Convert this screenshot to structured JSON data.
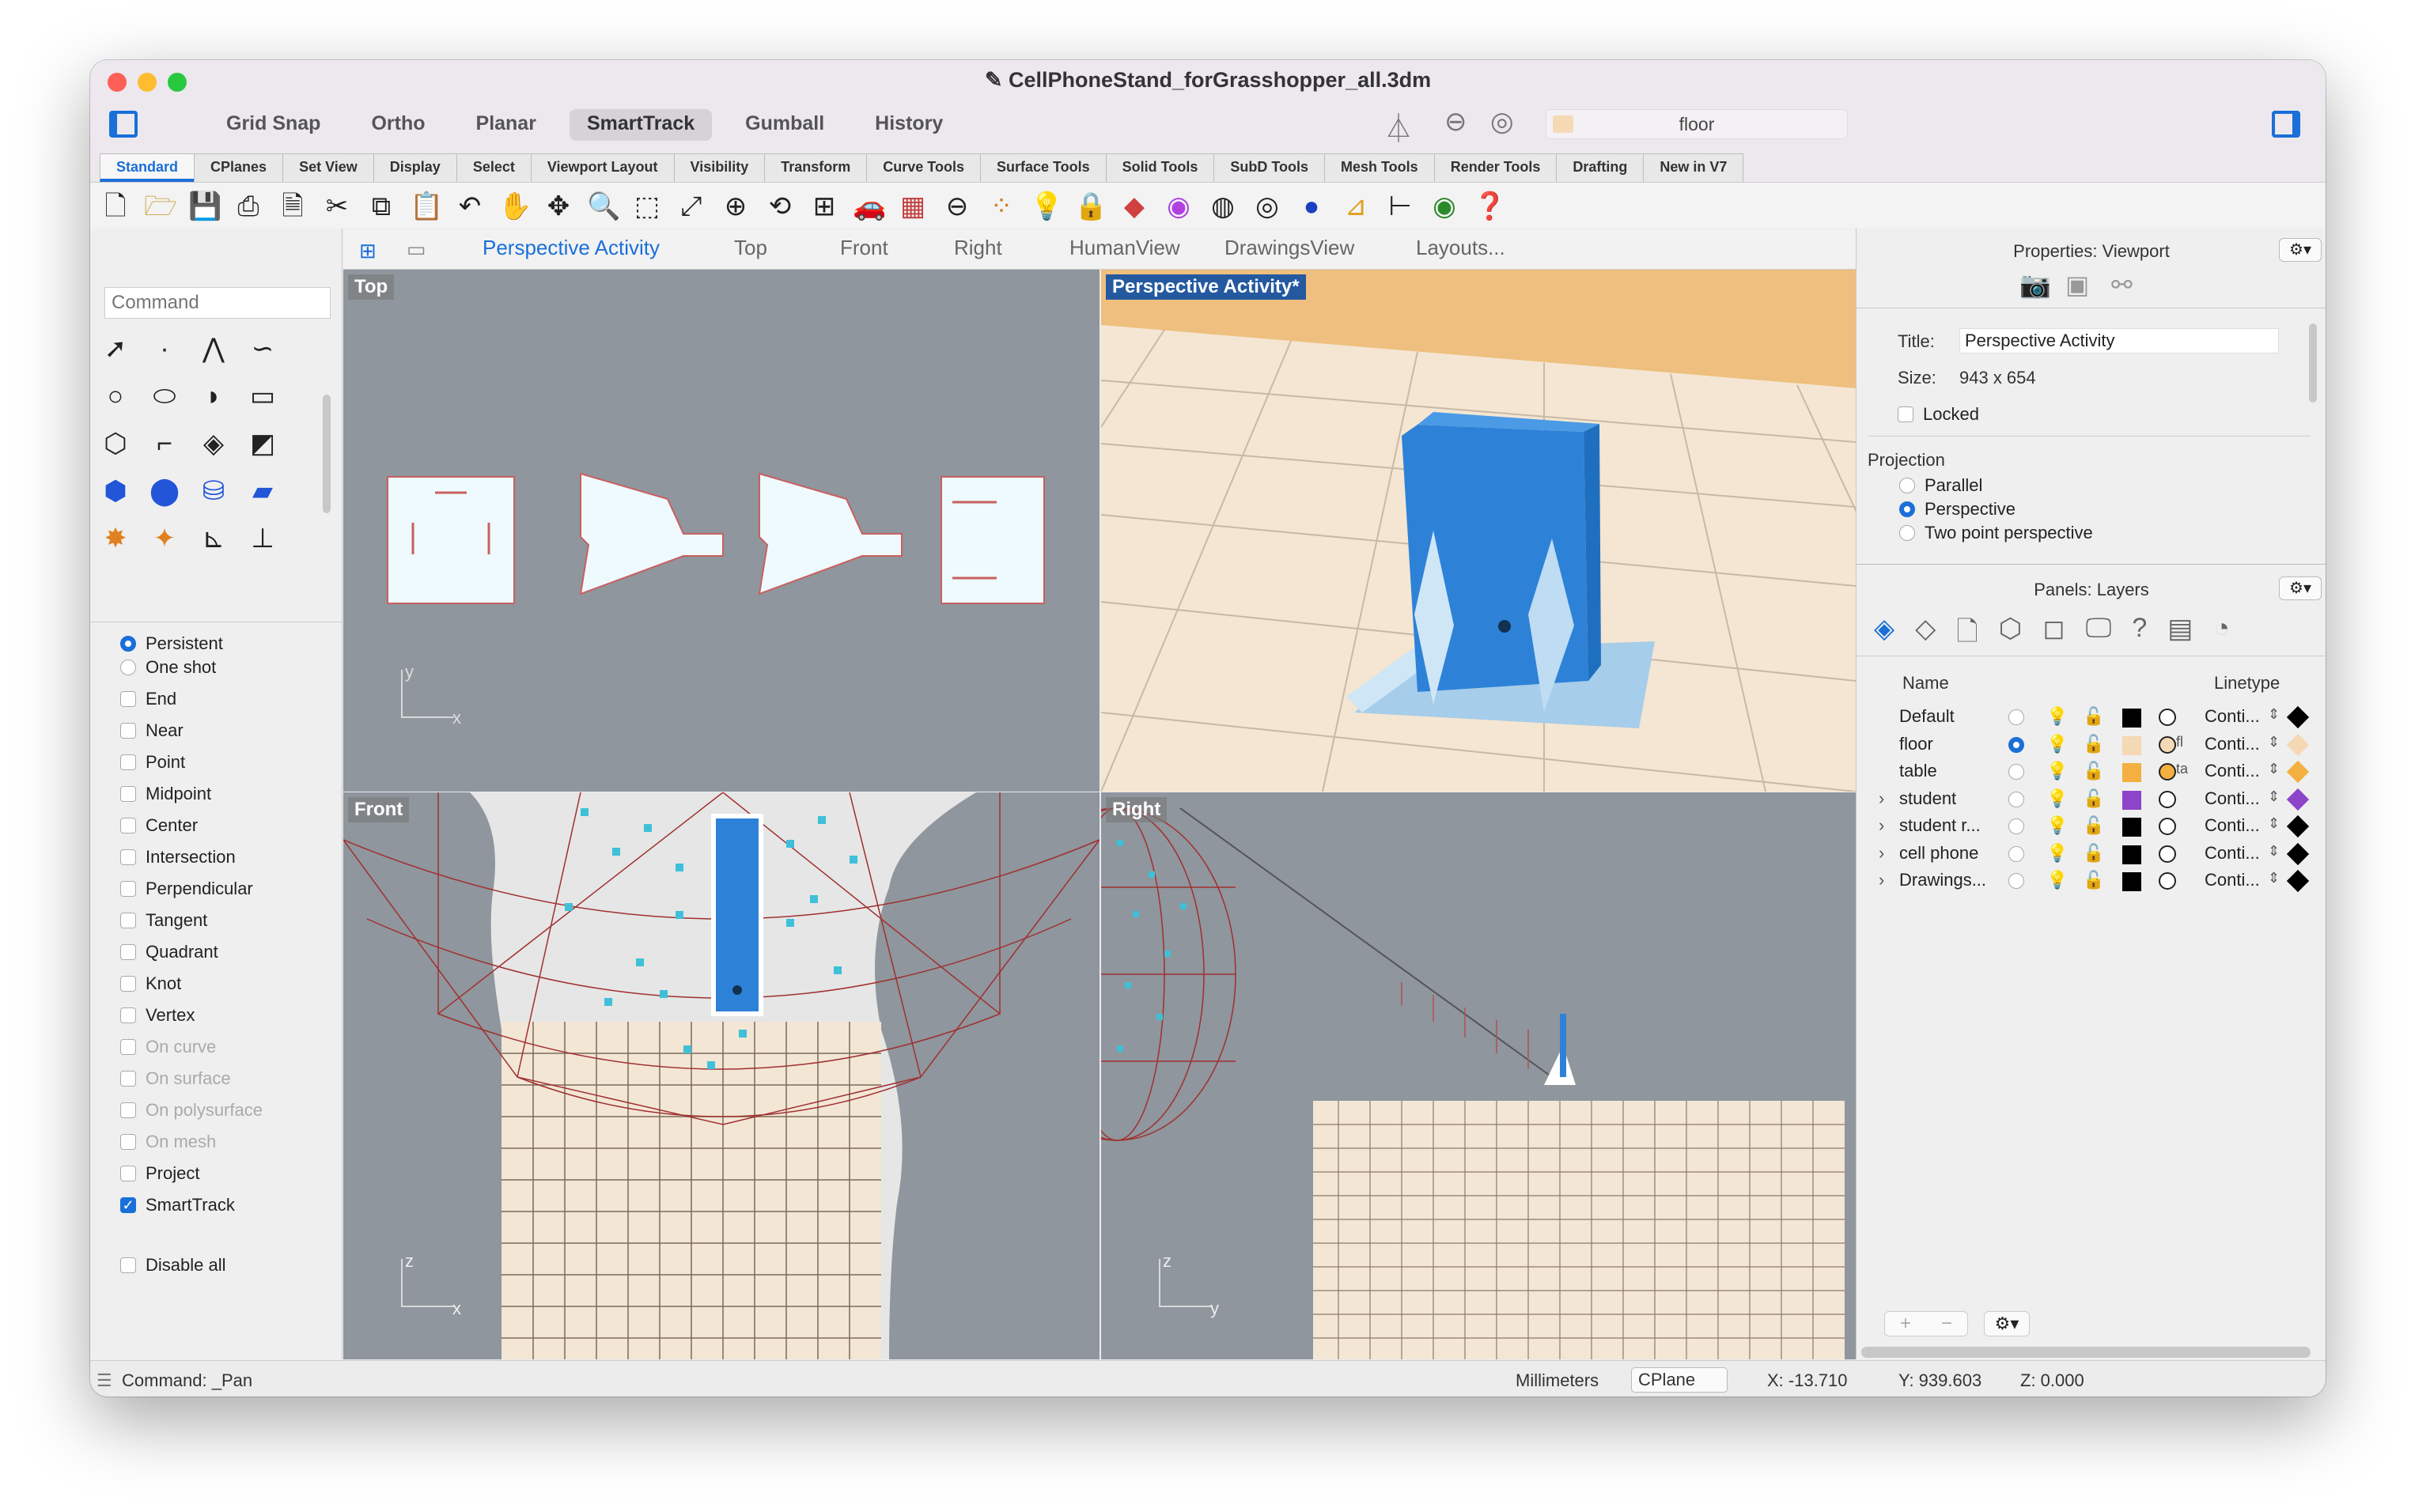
{
  "window": {
    "title": "CellPhoneStand_forGrasshopper_all.3dm"
  },
  "modes": [
    "Grid Snap",
    "Ortho",
    "Planar",
    "SmartTrack",
    "Gumball",
    "History"
  ],
  "active_mode": "SmartTrack",
  "current_layer": "floor",
  "tabs": [
    "Standard",
    "CPlanes",
    "Set View",
    "Display",
    "Select",
    "Viewport Layout",
    "Visibility",
    "Transform",
    "Curve Tools",
    "Surface Tools",
    "Solid Tools",
    "SubD Tools",
    "Mesh Tools",
    "Render Tools",
    "Drafting",
    "New in V7"
  ],
  "command": {
    "placeholder": "Command"
  },
  "osnap": {
    "persistent": "Persistent",
    "one_shot": "One shot",
    "items": [
      "End",
      "Near",
      "Point",
      "Midpoint",
      "Center",
      "Intersection",
      "Perpendicular",
      "Tangent",
      "Quadrant",
      "Knot",
      "Vertex"
    ],
    "disabled_items": [
      "On curve",
      "On surface",
      "On polysurface",
      "On mesh"
    ],
    "project": "Project",
    "smarttrack": "SmartTrack",
    "disable_all": "Disable all"
  },
  "viewport_tabs": [
    "Perspective Activity",
    "Top",
    "Front",
    "Right",
    "HumanView",
    "DrawingsView",
    "Layouts..."
  ],
  "viewports": {
    "top": "Top",
    "perspective": "Perspective Activity*",
    "front": "Front",
    "right": "Right"
  },
  "axes": {
    "x": "x",
    "y": "y",
    "z": "z"
  },
  "properties": {
    "header": "Properties: Viewport",
    "title_label": "Title:",
    "title_value": "Perspective Activity",
    "size_label": "Size:",
    "size_value": "943 x 654",
    "locked": "Locked",
    "projection": "Projection",
    "parallel": "Parallel",
    "perspective": "Perspective",
    "two_point": "Two point perspective"
  },
  "layers": {
    "header": "Panels: Layers",
    "col_name": "Name",
    "col_linetype": "Linetype",
    "rows": [
      {
        "name": "Default",
        "color": "#000000",
        "linetype": "Conti...",
        "current": false,
        "expandable": false,
        "mat": ""
      },
      {
        "name": "floor",
        "color": "#f4d9b4",
        "linetype": "Conti...",
        "current": true,
        "expandable": false,
        "mat": "fl"
      },
      {
        "name": "table",
        "color": "#f3b040",
        "linetype": "Conti...",
        "current": false,
        "expandable": false,
        "mat": "ta"
      },
      {
        "name": "student",
        "color": "#8d44c9",
        "linetype": "Conti...",
        "current": false,
        "expandable": true,
        "mat": ""
      },
      {
        "name": "student r...",
        "color": "#000000",
        "linetype": "Conti...",
        "current": false,
        "expandable": true,
        "mat": ""
      },
      {
        "name": "cell phone",
        "color": "#000000",
        "linetype": "Conti...",
        "current": false,
        "expandable": true,
        "mat": ""
      },
      {
        "name": "Drawings...",
        "color": "#000000",
        "linetype": "Conti...",
        "current": false,
        "expandable": true,
        "mat": ""
      }
    ]
  },
  "status": {
    "command": "Command: _Pan",
    "units": "Millimeters",
    "cplane": "CPlane",
    "x": "X: -13.710",
    "y": "Y: 939.603",
    "z": "Z: 0.000"
  },
  "colors": {
    "accent": "#1a6fd8",
    "viewport_bg": "#8f969d",
    "floor": "#f4e6d2",
    "phone": "#3a8de0"
  }
}
